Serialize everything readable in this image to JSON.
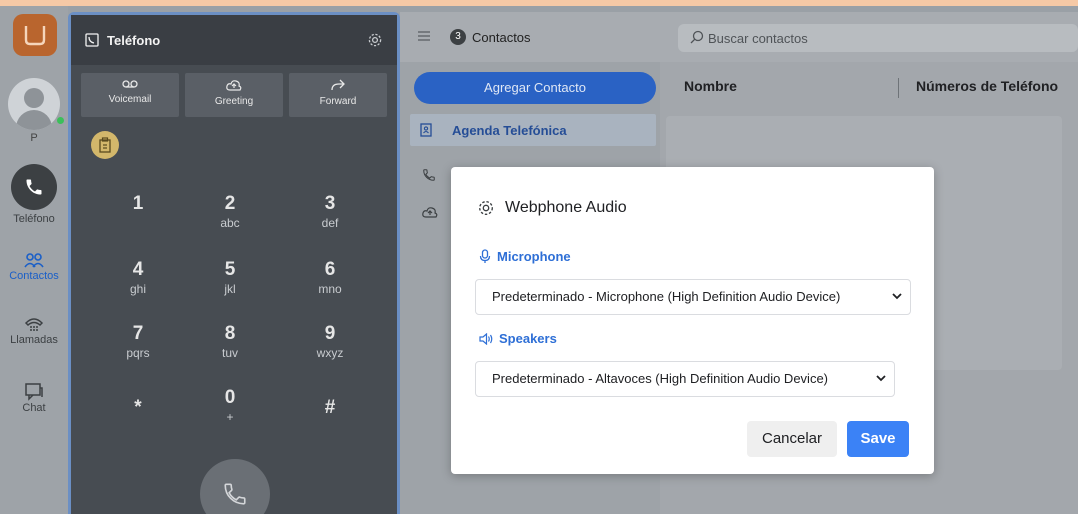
{
  "rail": {
    "user_initial": "P",
    "items": [
      {
        "label": "Teléfono"
      },
      {
        "label": "Contactos"
      },
      {
        "label": "Llamadas"
      },
      {
        "label": "Chat"
      }
    ]
  },
  "phone": {
    "title": "Teléfono",
    "buttons": [
      {
        "label": "Voicemail"
      },
      {
        "label": "Greeting"
      },
      {
        "label": "Forward"
      }
    ],
    "keys": [
      {
        "digit": "1",
        "letters": ""
      },
      {
        "digit": "2",
        "letters": "abc"
      },
      {
        "digit": "3",
        "letters": "def"
      },
      {
        "digit": "4",
        "letters": "ghi"
      },
      {
        "digit": "5",
        "letters": "jkl"
      },
      {
        "digit": "6",
        "letters": "mno"
      },
      {
        "digit": "7",
        "letters": "pqrs"
      },
      {
        "digit": "8",
        "letters": "tuv"
      },
      {
        "digit": "9",
        "letters": "wxyz"
      },
      {
        "digit": "*",
        "letters": ""
      },
      {
        "digit": "0",
        "letters": "+"
      },
      {
        "digit": "#",
        "letters": ""
      }
    ]
  },
  "contacts": {
    "count": "3",
    "title": "Contactos",
    "search_placeholder": "Buscar contactos",
    "add_button": "Agregar Contacto",
    "agenda_label": "Agenda Telefónica",
    "columns": {
      "name": "Nombre",
      "numbers": "Números de Teléfono"
    }
  },
  "modal": {
    "title": "Webphone Audio",
    "microphone_label": "Microphone",
    "microphone_value": "Predeterminado - Microphone (High Definition Audio Device)",
    "speakers_label": "Speakers",
    "speakers_value": "Predeterminado - Altavoces (High Definition Audio Device)",
    "cancel_label": "Cancelar",
    "save_label": "Save"
  },
  "colors": {
    "accent": "#3b82f6",
    "brand": "#e07a2e",
    "section_blue": "#2e6fd6",
    "add_button": "#2a62c4"
  }
}
